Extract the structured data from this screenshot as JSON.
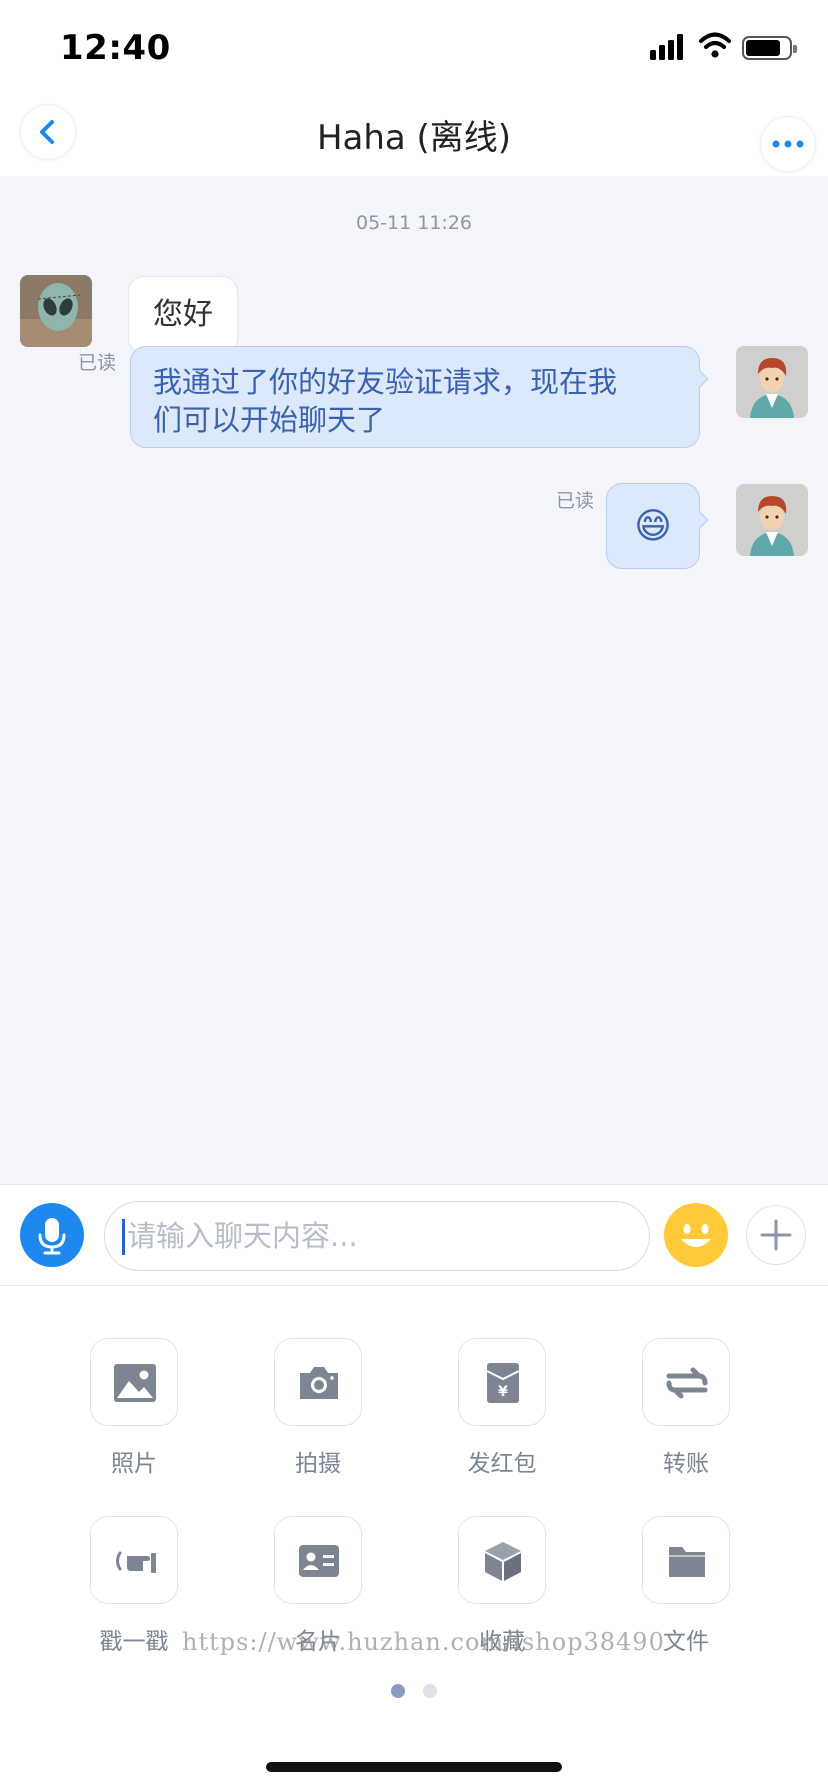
{
  "status_bar": {
    "time": "12:40",
    "battery_level": 0.8,
    "signal_bars": 4
  },
  "nav": {
    "title": "Haha (离线)",
    "back_icon": "chevron-left-icon",
    "more_icon": "ellipsis-icon"
  },
  "chat": {
    "timestamp": "05-11 11:26",
    "messages": [
      {
        "direction": "incoming",
        "text": "您好"
      },
      {
        "direction": "outgoing",
        "status": "已读",
        "lines": [
          "我通过了你的好友验证请求，现在我",
          "们可以开始聊天了"
        ]
      },
      {
        "direction": "outgoing",
        "status": "已读",
        "text": "😄"
      }
    ]
  },
  "input_bar": {
    "placeholder": "请输入聊天内容...",
    "value": ""
  },
  "panel": {
    "tools": [
      {
        "label": "照片",
        "icon": "photo-icon"
      },
      {
        "label": "拍摄",
        "icon": "camera-icon"
      },
      {
        "label": "发红包",
        "icon": "red-packet-icon"
      },
      {
        "label": "转账",
        "icon": "transfer-icon"
      },
      {
        "label": "戳一戳",
        "icon": "poke-icon"
      },
      {
        "label": "名片",
        "icon": "contact-card-icon"
      },
      {
        "label": "收藏",
        "icon": "favorites-box-icon"
      },
      {
        "label": "文件",
        "icon": "folder-icon"
      }
    ],
    "current_page": 1,
    "page_count": 2
  },
  "watermark": "https://www.huzhan.com/ishop38490",
  "colors": {
    "accent": "#1e88ee",
    "chat_bg": "#f3f5fa",
    "outgoing_bubble": "#dce8fb",
    "outgoing_text": "#3a62b0",
    "icon_gray": "#7d8593"
  }
}
